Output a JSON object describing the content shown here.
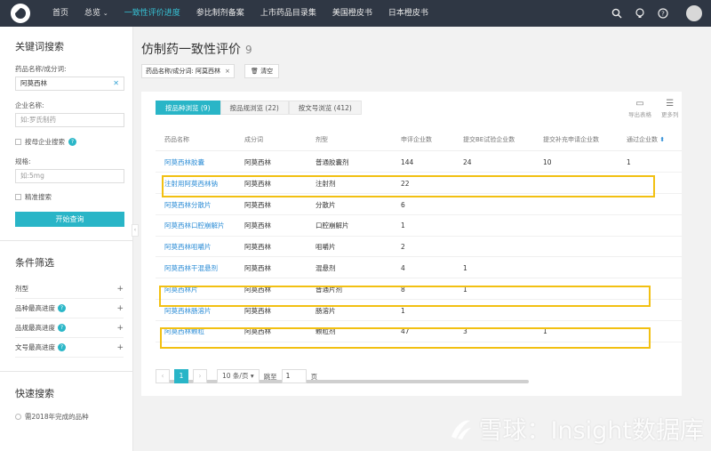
{
  "nav": {
    "items": [
      "首页",
      "总览",
      "一致性评价进度",
      "参比制剂备案",
      "上市药品目录集",
      "美国橙皮书",
      "日本橙皮书"
    ],
    "overview_arrow": "⌄"
  },
  "sidebar": {
    "keyword_title": "关键词搜索",
    "drug_label": "药品名称/成分词:",
    "drug_value": "阿莫西林",
    "company_label": "企业名称:",
    "company_placeholder": "如:罗氏制药",
    "parent_company_label": "按母企业搜索",
    "spec_label": "规格:",
    "spec_placeholder": "如:5mg",
    "exact_label": "精准搜索",
    "search_button": "开始查询",
    "filter_title": "条件筛选",
    "filters": [
      "剂型",
      "品种最高进度",
      "品规最高进度",
      "文号最高进度"
    ],
    "quick_title": "快速搜索",
    "quick_items": [
      "需2018年完成的品种"
    ]
  },
  "main": {
    "title": "仿制药一致性评价",
    "count": "9",
    "chip": "药品名称/成分词: 阿莫西林",
    "clear": "清空",
    "tabs": [
      "按品种浏览 (9)",
      "按品规浏览 (22)",
      "按文号浏览 (412)"
    ],
    "tools": [
      "导出表格",
      "更多列"
    ],
    "columns": [
      "药品名称",
      "成分词",
      "剂型",
      "申评企业数",
      "提交BE试验企业数",
      "提交补充申请企业数",
      "通过企业数"
    ],
    "rows": [
      {
        "name": "阿莫西林胶囊",
        "ingredient": "阿莫西林",
        "form": "普通胶囊剂",
        "c1": "144",
        "c2": "24",
        "c3": "10",
        "c4": "1"
      },
      {
        "name": "注射用阿莫西林钠",
        "ingredient": "阿莫西林",
        "form": "注射剂",
        "c1": "22",
        "c2": "",
        "c3": "",
        "c4": ""
      },
      {
        "name": "阿莫西林分散片",
        "ingredient": "阿莫西林",
        "form": "分散片",
        "c1": "6",
        "c2": "",
        "c3": "",
        "c4": ""
      },
      {
        "name": "阿莫西林口腔崩解片",
        "ingredient": "阿莫西林",
        "form": "口腔崩解片",
        "c1": "1",
        "c2": "",
        "c3": "",
        "c4": ""
      },
      {
        "name": "阿莫西林咀嚼片",
        "ingredient": "阿莫西林",
        "form": "咀嚼片",
        "c1": "2",
        "c2": "",
        "c3": "",
        "c4": ""
      },
      {
        "name": "阿莫西林干混悬剂",
        "ingredient": "阿莫西林",
        "form": "混悬剂",
        "c1": "4",
        "c2": "1",
        "c3": "",
        "c4": ""
      },
      {
        "name": "阿莫西林片",
        "ingredient": "阿莫西林",
        "form": "普通片剂",
        "c1": "8",
        "c2": "1",
        "c3": "",
        "c4": ""
      },
      {
        "name": "阿莫西林肠溶片",
        "ingredient": "阿莫西林",
        "form": "肠溶片",
        "c1": "1",
        "c2": "",
        "c3": "",
        "c4": ""
      },
      {
        "name": "阿莫西林颗粒",
        "ingredient": "阿莫西林",
        "form": "颗粒剂",
        "c1": "47",
        "c2": "3",
        "c3": "1",
        "c4": ""
      }
    ],
    "pager": {
      "prev": "‹",
      "page": "1",
      "next": "›",
      "size": "10 条/页",
      "goto_label": "跳至",
      "goto_value": "1",
      "page_unit": "页"
    }
  },
  "watermark": "雪球：Insight数据库",
  "colors": {
    "accent": "#29b5c7",
    "nav_bg": "#2f3744",
    "link": "#2b8cd6",
    "highlight": "#f2c012"
  }
}
